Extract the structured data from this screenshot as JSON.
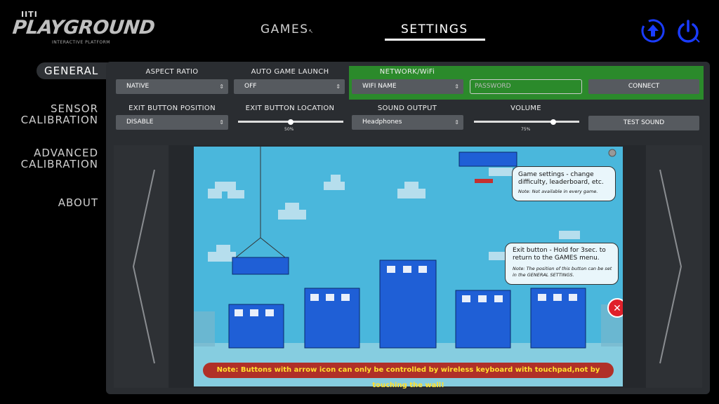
{
  "logo": {
    "top": "IITI",
    "main": "PLAYGROUND",
    "sub": "INTERACTIVE PLATFORM"
  },
  "nav": {
    "games": "GAMES",
    "settings": "SETTINGS",
    "active": "settings"
  },
  "header_icons": [
    "update-icon",
    "power-icon"
  ],
  "accent_color": "#1a3cff",
  "sidebar": {
    "items": [
      {
        "label": "GENERAL",
        "active": true
      },
      {
        "label_line1": "SENSOR",
        "label_line2": "CALIBRATION"
      },
      {
        "label_line1": "ADVANCED",
        "label_line2": "CALIBRATION"
      },
      {
        "label": "ABOUT"
      }
    ]
  },
  "settings": {
    "aspect_ratio": {
      "label": "ASPECT RATIO",
      "value": "NATIVE"
    },
    "auto_game_launch": {
      "label": "AUTO GAME LAUNCH",
      "value": "OFF"
    },
    "network": {
      "label": "NETWORK/WiFi",
      "wifi_value": "WIFI NAME",
      "password_placeholder": "PASSWORD",
      "connect_label": "CONNECT"
    },
    "exit_button_position": {
      "label": "EXIT BUTTON POSITION",
      "value": "DISABLE"
    },
    "exit_button_location": {
      "label": "EXIT BUTTON LOCATION",
      "value_text": "50%",
      "value": 0.5
    },
    "sound_output": {
      "label": "SOUND OUTPUT",
      "value": "Headphones"
    },
    "volume": {
      "label": "VOLUME",
      "value_text": "75%",
      "value": 0.75
    },
    "test_sound_label": "TEST SOUND"
  },
  "preview": {
    "bubble1": {
      "title": "Game settings - change difficulty, leaderboard, etc.",
      "note": "Note: Not available in every game."
    },
    "bubble2": {
      "title": "Exit button - Hold for 3sec. to return to the GAMES menu.",
      "note": "Note: The position of this button can be set in the GENERAL SETTINGS."
    },
    "note_bar": "Note: Buttons with arrow icon  can only be controlled by wireless keyboard with touchpad,not by touching the wall!"
  }
}
